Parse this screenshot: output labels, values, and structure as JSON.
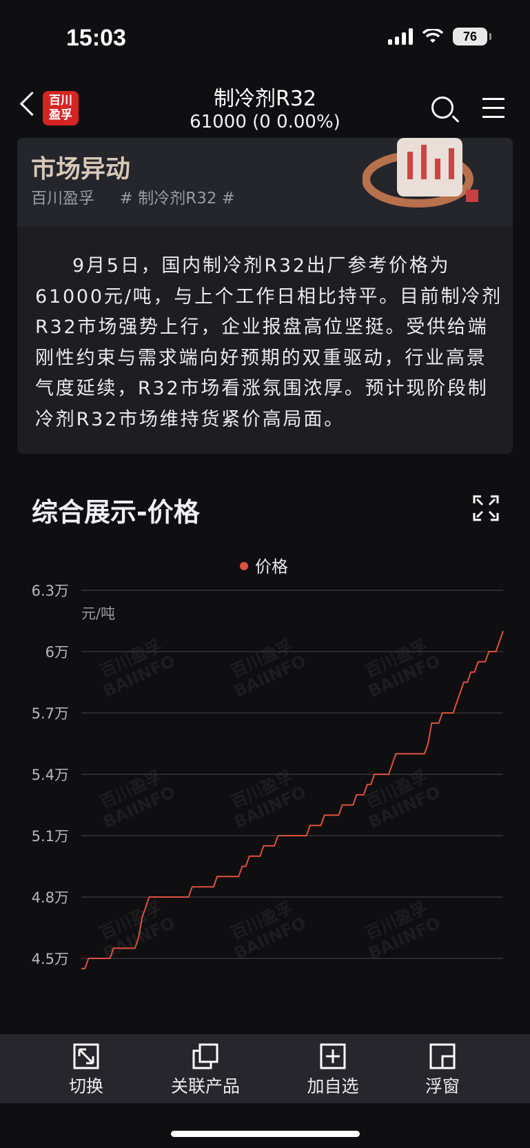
{
  "status": {
    "time": "15:03",
    "battery": "76"
  },
  "header": {
    "logo_line1": "百川",
    "logo_line2": "盈孚",
    "title": "制冷剂R32",
    "subtitle": "61000 (0  0.00%)"
  },
  "card": {
    "title": "市场异动",
    "source": "百川盈孚",
    "tag": "# 制冷剂R32 #",
    "body": "9月5日，国内制冷剂R32出厂参考价格为61000元/吨，与上个工作日相比持平。目前制冷剂R32市场强势上行，企业报盘高位坚挺。受供给端刚性约束与需求端向好预期的双重驱动，行业高景气度延续，R32市场看涨氛围浓厚。预计现阶段制冷剂R32市场维持货紧价高局面。"
  },
  "section": {
    "title": "综合展示-价格"
  },
  "chart_data": {
    "type": "line",
    "ylabel": "元/吨",
    "yticks": [
      "6.3万",
      "6万",
      "5.7万",
      "5.4万",
      "5.1万",
      "4.8万",
      "4.5万"
    ],
    "ylim": [
      45000,
      63000
    ],
    "legend": [
      "价格"
    ],
    "series": [
      {
        "name": "价格",
        "color": "#e0513e",
        "values": [
          44500,
          44500,
          45000,
          45000,
          45000,
          45000,
          45000,
          45000,
          45000,
          45500,
          45500,
          45500,
          45500,
          45500,
          45500,
          45500,
          46000,
          47000,
          47500,
          48000,
          48000,
          48000,
          48000,
          48000,
          48000,
          48000,
          48000,
          48000,
          48000,
          48000,
          48000,
          48500,
          48500,
          48500,
          48500,
          48500,
          48500,
          48500,
          49000,
          49000,
          49000,
          49000,
          49000,
          49000,
          49000,
          49500,
          49500,
          50000,
          50000,
          50000,
          50000,
          50500,
          50500,
          50500,
          50500,
          51000,
          51000,
          51000,
          51000,
          51000,
          51000,
          51000,
          51000,
          51000,
          51500,
          51500,
          51500,
          51500,
          52000,
          52000,
          52000,
          52000,
          52000,
          52500,
          52500,
          52500,
          52500,
          53000,
          53000,
          53000,
          53500,
          53500,
          54000,
          54000,
          54000,
          54000,
          54000,
          54500,
          55000,
          55000,
          55000,
          55000,
          55000,
          55000,
          55000,
          55000,
          55000,
          55500,
          56500,
          56500,
          56500,
          57000,
          57000,
          57000,
          57000,
          57500,
          58000,
          58500,
          58500,
          59000,
          59000,
          59500,
          59500,
          59500,
          60000,
          60000,
          60000,
          60500,
          61000
        ]
      }
    ]
  },
  "watermark": {
    "line1": "百川盈孚",
    "line2": "BAIINFO"
  },
  "tabbar": [
    {
      "label": "切换",
      "icon": "swap-icon"
    },
    {
      "label": "关联产品",
      "icon": "related-products-icon"
    },
    {
      "label": "加自选",
      "icon": "add-watchlist-icon"
    },
    {
      "label": "浮窗",
      "icon": "floating-window-icon"
    }
  ]
}
